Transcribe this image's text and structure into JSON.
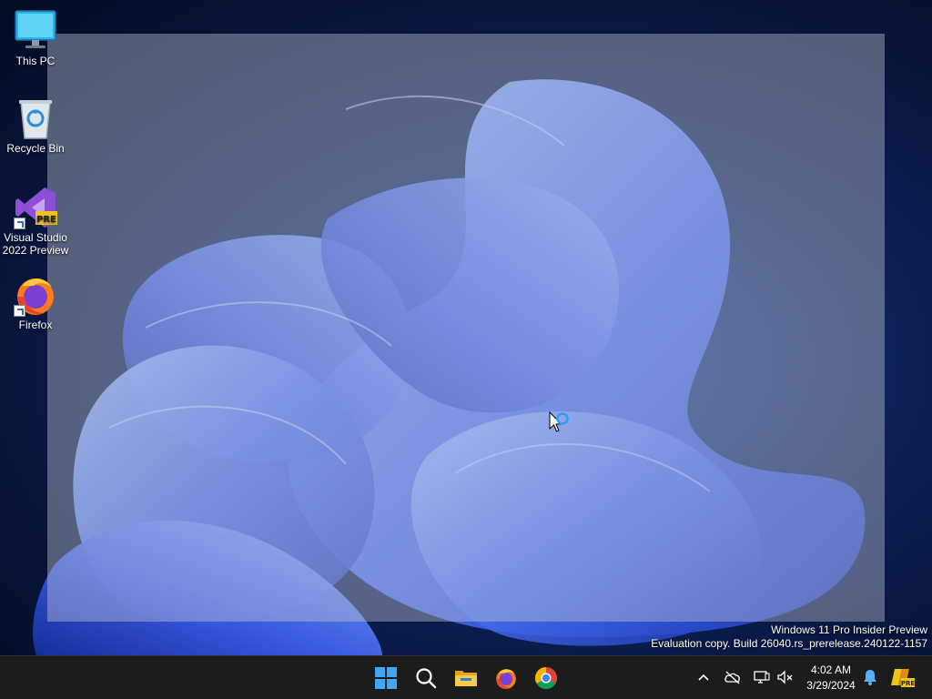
{
  "desktop": {
    "icons": [
      {
        "label": "This PC",
        "icon": "monitor-icon"
      },
      {
        "label": "Recycle Bin",
        "icon": "recycle-bin-icon"
      },
      {
        "label": "Visual Studio 2022 Preview",
        "icon": "visual-studio-icon",
        "badge": "PRE"
      },
      {
        "label": "Firefox",
        "icon": "firefox-icon"
      }
    ]
  },
  "watermark": {
    "line1": "Windows 11 Pro Insider Preview",
    "line2": "Evaluation copy. Build 26040.rs_prerelease.240122-1157"
  },
  "taskbar": {
    "pinned": [
      "start-icon",
      "search-icon",
      "file-explorer-icon",
      "firefox-icon",
      "chrome-icon"
    ],
    "tray": [
      "chevron-up-icon",
      "cloud-offline-icon",
      "network-icon",
      "volume-muted-icon",
      "notification-bell-icon",
      "dev-home-icon"
    ],
    "tray_badge": "PRE",
    "time": "4:02 AM",
    "date": "3/29/2024"
  },
  "colors": {
    "taskbar": "#1c1c1c",
    "accent": "#2aa0f0",
    "wallpaper": "#1a3b8c"
  }
}
